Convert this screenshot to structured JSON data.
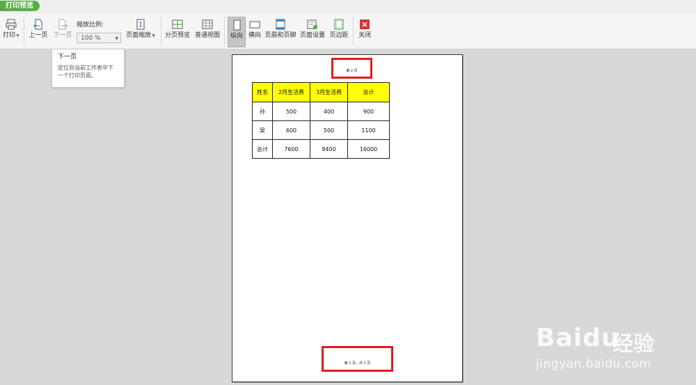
{
  "mode_tab": "打印预览",
  "toolbar": {
    "print": "打印",
    "prev_page": "上一页",
    "next_page": "下一页",
    "zoom_label": "缩放比例:",
    "zoom_value": "100 %",
    "page_zoom": "页面缩放",
    "page_break_preview": "分页预览",
    "normal_view": "普通视图",
    "portrait": "纵向",
    "landscape": "横向",
    "header_footer": "页眉和页脚",
    "page_setup": "页面设置",
    "margins": "页边距",
    "close": "关闭"
  },
  "tooltip": {
    "title": "下一页",
    "description_line1": "定位到当前工作表中下",
    "description_line2": "一个打印页面。"
  },
  "page": {
    "header": "第 2 页",
    "footer": "第 2 页，共 2 页"
  },
  "table": {
    "headers": [
      "姓名",
      "2月生活费",
      "3月生活费",
      "总计"
    ],
    "rows": [
      [
        "孙",
        "500",
        "400",
        "900"
      ],
      [
        "吴",
        "600",
        "500",
        "1100"
      ],
      [
        "总计",
        "7600",
        "8400",
        "16000"
      ]
    ]
  },
  "watermark": {
    "brand": "Baidu",
    "brand_cn": "经验",
    "url": "jingyan.baidu.com"
  },
  "colors": {
    "accent_green": "#5aad46",
    "highlight_red": "#e21a1a",
    "header_fill": "#ffff00",
    "close_red": "#e03030"
  }
}
